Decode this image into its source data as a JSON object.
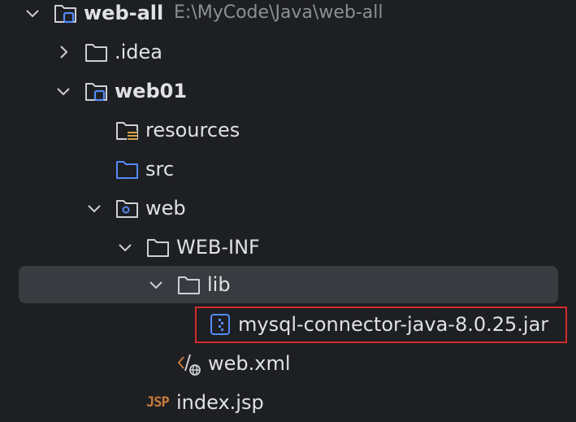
{
  "tree": {
    "root": {
      "name": "web-all",
      "path": "E:\\MyCode\\Java\\web-all",
      "icon": "module-folder-icon",
      "expanded": true
    },
    "nodes": [
      {
        "name": ".idea",
        "icon": "folder-icon",
        "expanded": false
      },
      {
        "name": "web01",
        "icon": "module-folder-icon",
        "expanded": true
      },
      {
        "name": "resources",
        "icon": "resources-folder-icon"
      },
      {
        "name": "src",
        "icon": "source-folder-icon"
      },
      {
        "name": "web",
        "icon": "web-folder-icon",
        "expanded": true
      },
      {
        "name": "WEB-INF",
        "icon": "folder-icon",
        "expanded": true
      },
      {
        "name": "lib",
        "icon": "folder-icon",
        "expanded": true,
        "selected": true
      },
      {
        "name": "mysql-connector-java-8.0.25.jar",
        "icon": "jar-icon",
        "highlighted": true
      },
      {
        "name": "web.xml",
        "icon": "xml-web-icon"
      },
      {
        "name": "index.jsp",
        "icon": "jsp-icon",
        "badge": "JSP"
      }
    ]
  },
  "colors": {
    "background": "#1e1f22",
    "selection": "#393b40",
    "text": "#dfe1e5",
    "path_text": "#8c8f94",
    "folder_stroke": "#ced0d6",
    "module_blue": "#548af7",
    "highlight_red": "#d22b2b",
    "jsp_orange": "#c77b3a",
    "resources_yellow": "#d9a343"
  }
}
